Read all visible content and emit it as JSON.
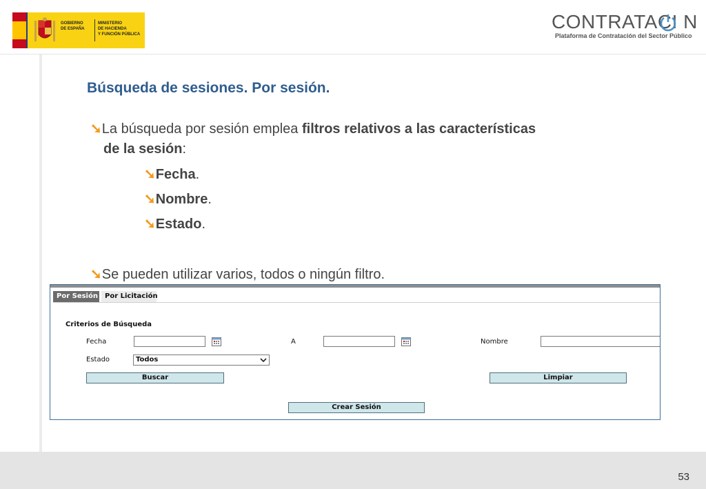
{
  "header": {
    "gov_logo": {
      "line1": "GOBIERNO\nDE ESPAÑA",
      "line2": "MINISTERIO\nDE HACIENDA\nY FUNCIÓN PÚBLICA"
    },
    "brand": {
      "title": "CONTRATACI N",
      "subtitle": "Plataforma de Contratación del Sector Público"
    }
  },
  "slide": {
    "title": "Búsqueda de sesiones. Por sesión.",
    "bullet1_pre": "La búsqueda por sesión emplea ",
    "bullet1_bold": "filtros relativos a las características",
    "bullet1_line2_bold": "de la sesión",
    "bullet1_line2_post": ":",
    "sub_items": [
      {
        "bold": "Fecha",
        "post": "."
      },
      {
        "bold": "Nombre",
        "post": "."
      },
      {
        "bold": "Estado",
        "post": "."
      }
    ],
    "bullet2": "Se pueden utilizar varios, todos o ningún filtro.",
    "bullet_symbol": "➘"
  },
  "form": {
    "tabs": [
      "Por Sesión",
      "Por Licitación"
    ],
    "criteria_title": "Criterios de Búsqueda",
    "labels": {
      "fecha": "Fecha",
      "a": "A",
      "nombre": "Nombre",
      "estado": "Estado"
    },
    "estado_value": "Todos",
    "buttons": {
      "buscar": "Buscar",
      "limpiar": "Limpiar",
      "crear": "Crear Sesión"
    }
  },
  "footer": {
    "page_number": "53"
  },
  "colors": {
    "title": "#2f5d8e",
    "bullet": "#f29a1f",
    "button_bg": "#cfe6ea",
    "footer_bg": "#e4e4e4"
  }
}
